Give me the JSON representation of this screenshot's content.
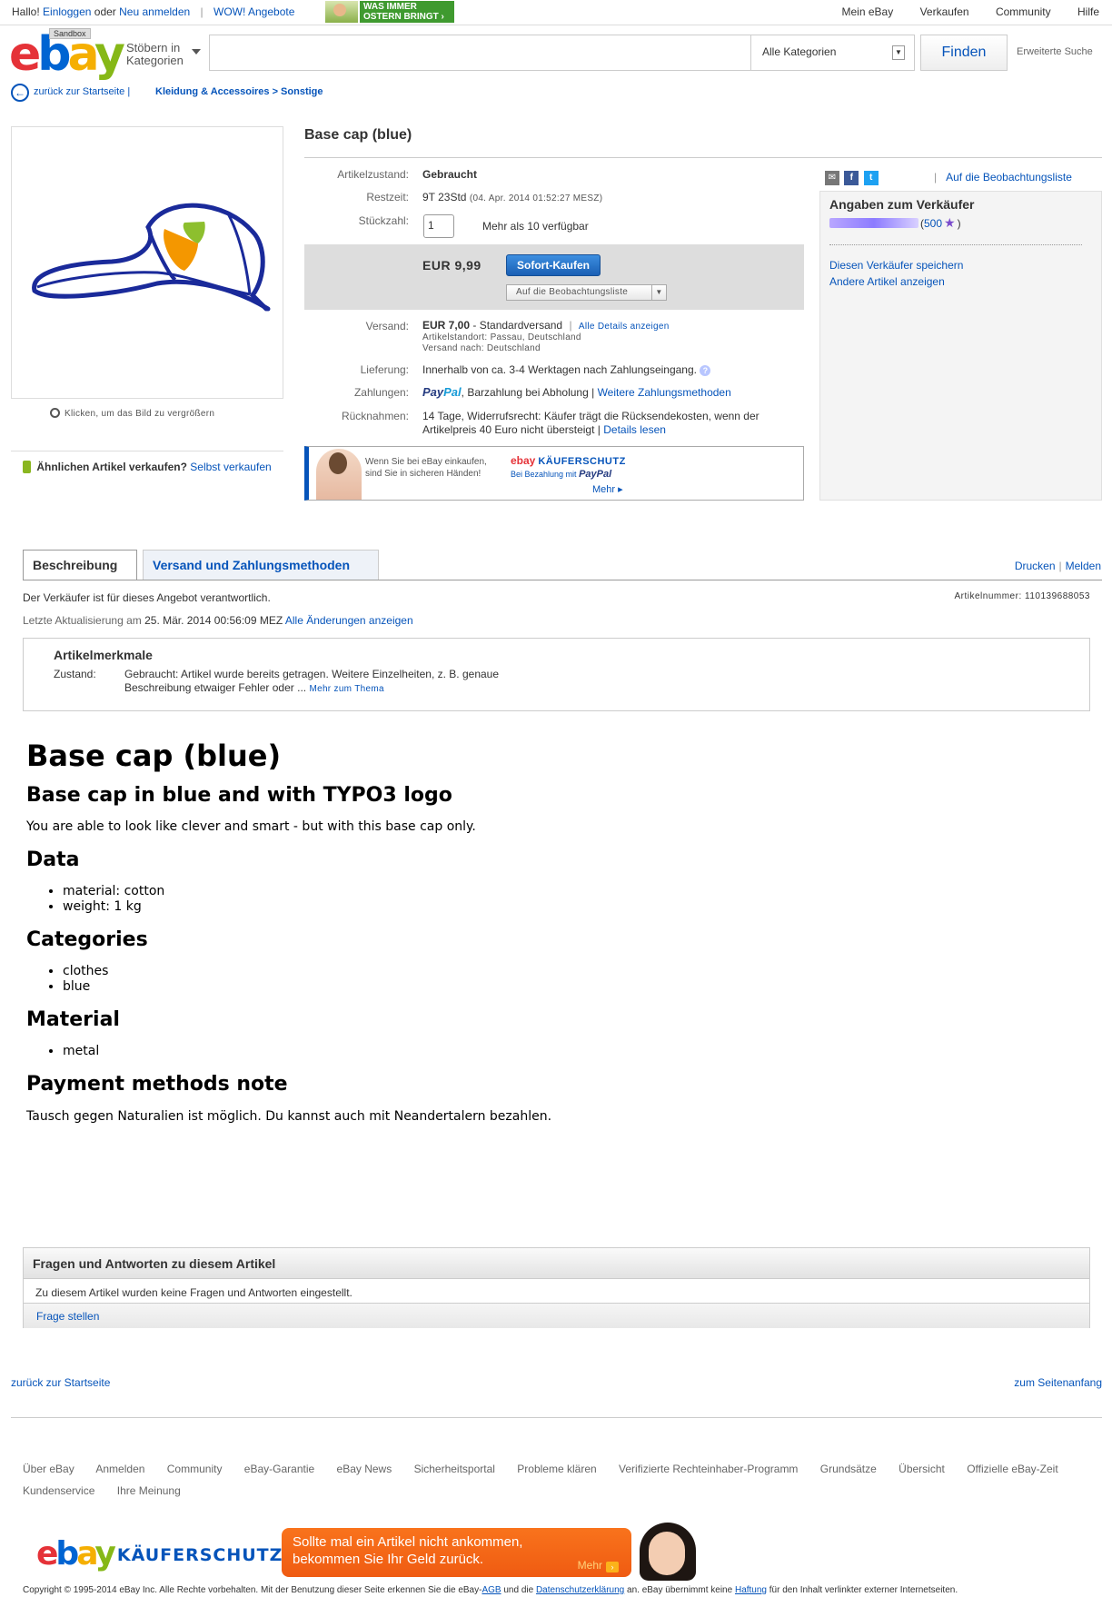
{
  "topbar": {
    "greeting": "Hallo!",
    "login": "Einloggen",
    "or": "oder",
    "register": "Neu anmelden",
    "wow": "WOW! Angebote",
    "promo_line1": "WAS IMMER",
    "promo_line2": "OSTERN BRINGT ›",
    "nav": [
      "Mein eBay",
      "Verkaufen",
      "Community",
      "Hilfe"
    ]
  },
  "header": {
    "logo_letters": [
      "e",
      "b",
      "a",
      "y"
    ],
    "sandbox": "Sandbox",
    "browse": "Stöbern in Kategorien",
    "search_value": "",
    "category": "Alle Kategorien",
    "find": "Finden",
    "advanced": "Erweiterte Suche"
  },
  "breadcrumb": {
    "back": "zurück zur Startseite |",
    "path": "Kleidung & Accessoires > Sonstige"
  },
  "image": {
    "zoom_hint": "Klicken, um das Bild zu vergrößern",
    "similar_bold": "Ähnlichen Artikel verkaufen?",
    "similar_link": "Selbst verkaufen"
  },
  "item": {
    "title": "Base cap (blue)",
    "condition_label": "Artikelzustand:",
    "condition": "Gebraucht",
    "time_label": "Restzeit:",
    "time_left": "9T 23Std",
    "end_date": "(04. Apr. 2014 01:52:27 MESZ)",
    "qty_label": "Stückzahl:",
    "qty_value": "1",
    "available": "Mehr als 10 verfügbar",
    "price": "EUR 9,99",
    "buy_now": "Sofort-Kaufen",
    "watch": "Auf die Beobachtungsliste",
    "shipping_label": "Versand:",
    "shipping_price": "EUR 7,00",
    "shipping_type": " - Standardversand",
    "shipping_details": "Alle Details anzeigen",
    "item_location": "Artikelstandort: Passau, Deutschland",
    "ships_to": "Versand nach: Deutschland",
    "delivery_label": "Lieferung:",
    "delivery": "Innerhalb von ca. 3-4 Werktagen nach Zahlungseingang.",
    "payment_label": "Zahlungen:",
    "paypal_a": "Pay",
    "paypal_b": "Pal",
    "payment_other": ", Barzahlung bei Abholung |",
    "payment_more": "Weitere Zahlungsmethoden",
    "returns_label": "Rücknahmen:",
    "returns": "14 Tage, Widerrufsrecht: Käufer trägt die Rücksendekosten, wenn der Artikelpreis 40 Euro nicht übersteigt |",
    "returns_more": "Details lesen"
  },
  "protection_banner": {
    "text1": "Wenn Sie bei eBay einkaufen,",
    "text2": "sind Sie in sicheren Händen!",
    "ebay": "ebay",
    "title": "KÄUFERSCHUTZ",
    "sub": "Bei Bezahlung mit",
    "paypal": "PayPal",
    "more": "Mehr ▸"
  },
  "seller": {
    "watch_link": "Auf die Beobachtungsliste",
    "heading": "Angaben zum Verkäufer",
    "feedback_score": "500",
    "save_seller": "Diesen Verkäufer speichern",
    "other_items": "Andere Artikel anzeigen"
  },
  "tabs": {
    "description": "Beschreibung",
    "shipping": "Versand und Zahlungsmethoden",
    "print": "Drucken",
    "report": "Melden"
  },
  "listing_info": {
    "responsible": "Der Verkäufer ist für dieses Angebot verantwortlich.",
    "item_number": "Artikelnummer: 110139688053",
    "last_update_label": "Letzte Aktualisierung am",
    "last_update_date": "25. Mär. 2014 00:56:09 MEZ",
    "all_changes": "Alle Änderungen anzeigen"
  },
  "attributes": {
    "heading": "Artikelmerkmale",
    "key": "Zustand:",
    "value": "Gebraucht: Artikel wurde bereits getragen. Weitere Einzelheiten, z. B. genaue Beschreibung etwaiger Fehler oder ...",
    "more": "Mehr zum Thema"
  },
  "description": {
    "h1": "Base cap (blue)",
    "h2": "Base cap in blue and with TYPO3 logo",
    "intro": "You are able to look like clever and smart - but with this base cap only.",
    "data_heading": "Data",
    "data": [
      "material: cotton",
      "weight: 1 kg"
    ],
    "categories_heading": "Categories",
    "categories": [
      "clothes",
      "blue"
    ],
    "material_heading": "Material",
    "material": [
      "metal"
    ],
    "payment_heading": "Payment methods note",
    "payment_note": "Tausch gegen Naturalien ist möglich. Du kannst auch mit Neandertalern bezahlen."
  },
  "qa": {
    "heading": "Fragen und Antworten zu diesem Artikel",
    "empty": "Zu diesem Artikel wurden keine Fragen und Antworten eingestellt.",
    "ask": "Frage stellen"
  },
  "footer": {
    "back_home": "zurück zur Startseite",
    "top": "zum Seitenanfang",
    "links": [
      "Über eBay",
      "Anmelden",
      "Community",
      "eBay-Garantie",
      "eBay News",
      "Sicherheitsportal",
      "Probleme klären",
      "Verifizierte Rechteinhaber-Programm",
      "Grundsätze",
      "Übersicht",
      "Offizielle eBay-Zeit",
      "Kundenservice",
      "Ihre Meinung"
    ],
    "banner_title": "KÄUFERSCHUTZ",
    "banner_text": "Sollte mal ein Artikel nicht ankommen, bekommen Sie Ihr Geld zurück.",
    "banner_more": "Mehr",
    "copyright_a": "Copyright © 1995-2014 eBay Inc. Alle Rechte vorbehalten. Mit der Benutzung dieser Seite erkennen Sie die eBay-",
    "agb": "AGB",
    "copyright_b": " und die ",
    "privacy": "Datenschutzerklärung",
    "copyright_c": " an. eBay übernimmt keine ",
    "liability": "Haftung",
    "copyright_d": " für den Inhalt verlinkter externer Internetseiten."
  },
  "colors": {
    "link": "#0654ba",
    "cap_blue": "#1a2a9a",
    "typo3_orange": "#f49700",
    "typo3_green": "#8dbf2e"
  }
}
